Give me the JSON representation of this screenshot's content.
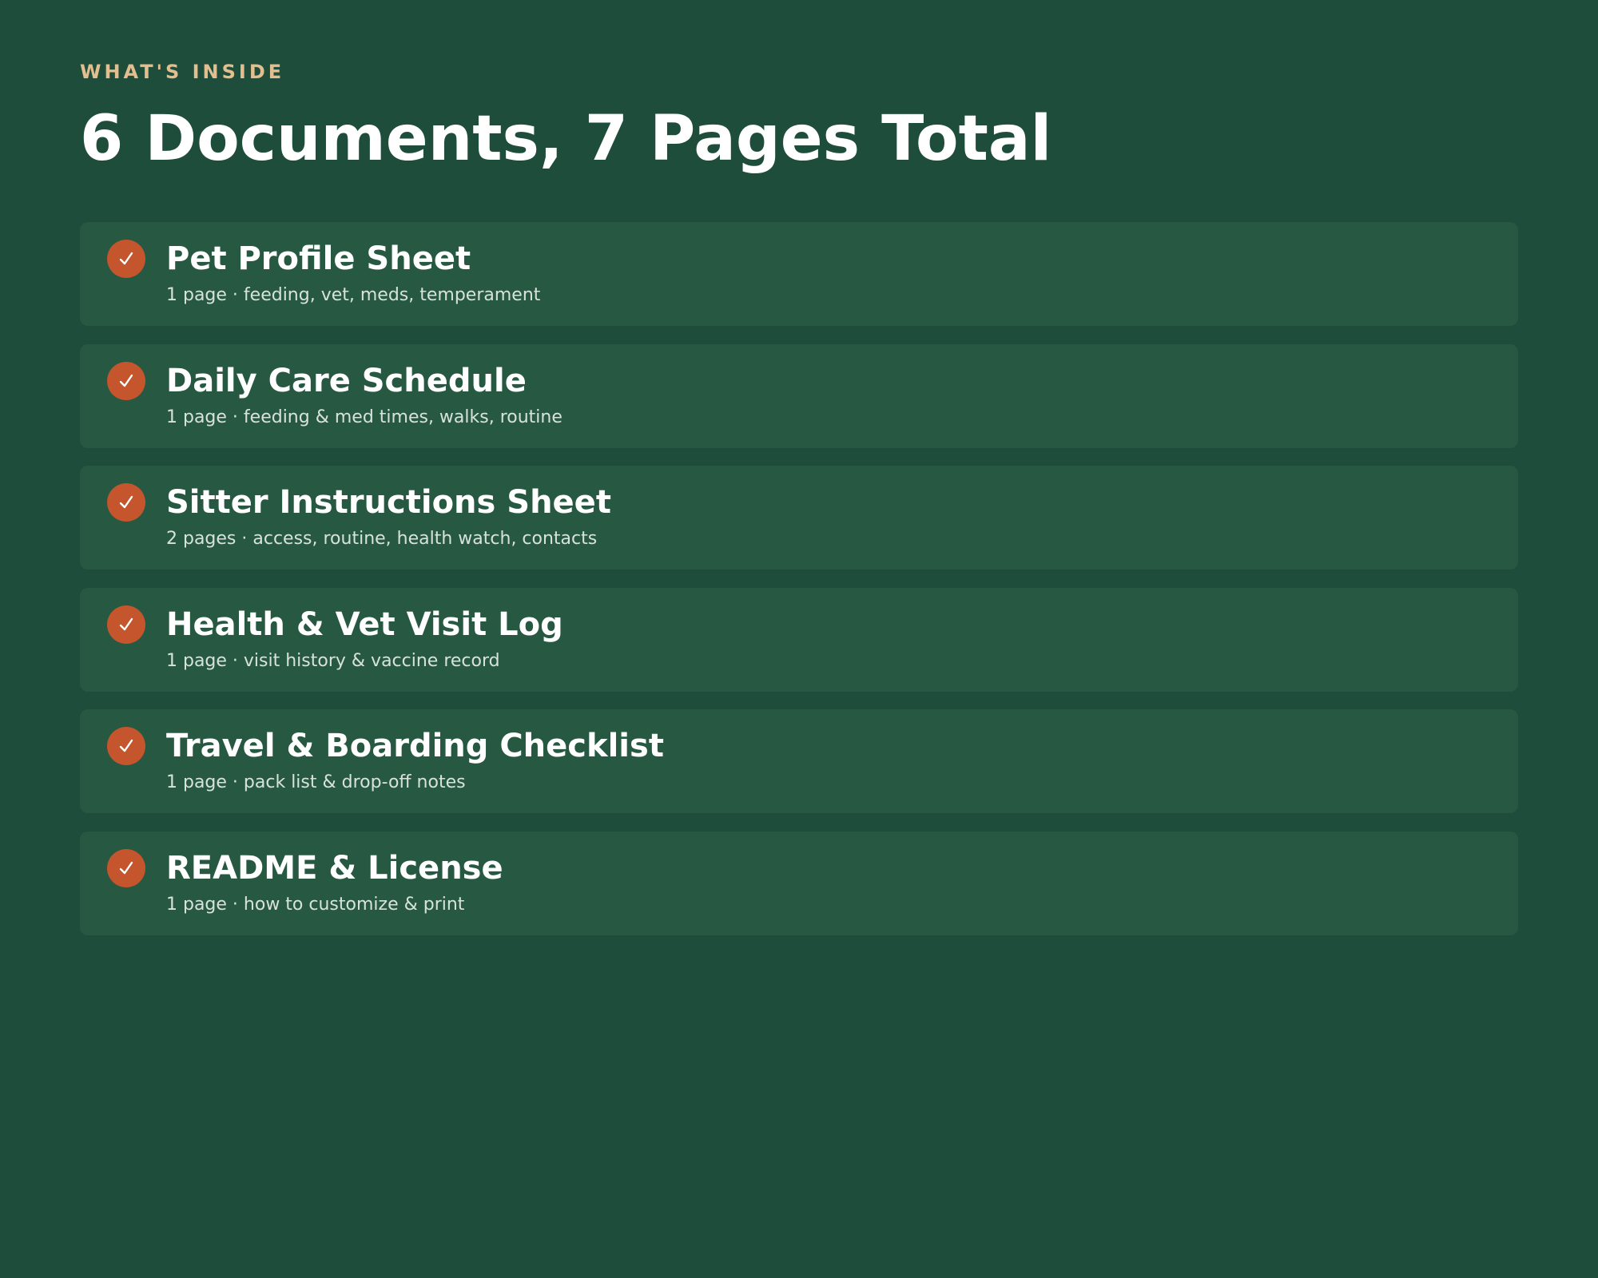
{
  "header": {
    "eyebrow": "WHAT'S INSIDE",
    "title": "6 Documents, 7 Pages Total"
  },
  "documents": [
    {
      "title": "Pet Profile Sheet",
      "description": "1 page · feeding, vet, meds, temperament"
    },
    {
      "title": "Daily Care Schedule",
      "description": "1 page · feeding & med times, walks, routine"
    },
    {
      "title": "Sitter Instructions Sheet",
      "description": "2 pages · access, routine, health watch, contacts"
    },
    {
      "title": "Health & Vet Visit Log",
      "description": "1 page · visit history & vaccine record"
    },
    {
      "title": "Travel & Boarding Checklist",
      "description": "1 page · pack list & drop-off notes"
    },
    {
      "title": "README & License",
      "description": "1 page · how to customize & print"
    }
  ],
  "icons": {
    "check": "check-icon"
  },
  "colors": {
    "background": "#1f4d3b",
    "card": "#275942",
    "accent": "#c4552d",
    "eyebrow": "#e3bf8f"
  }
}
